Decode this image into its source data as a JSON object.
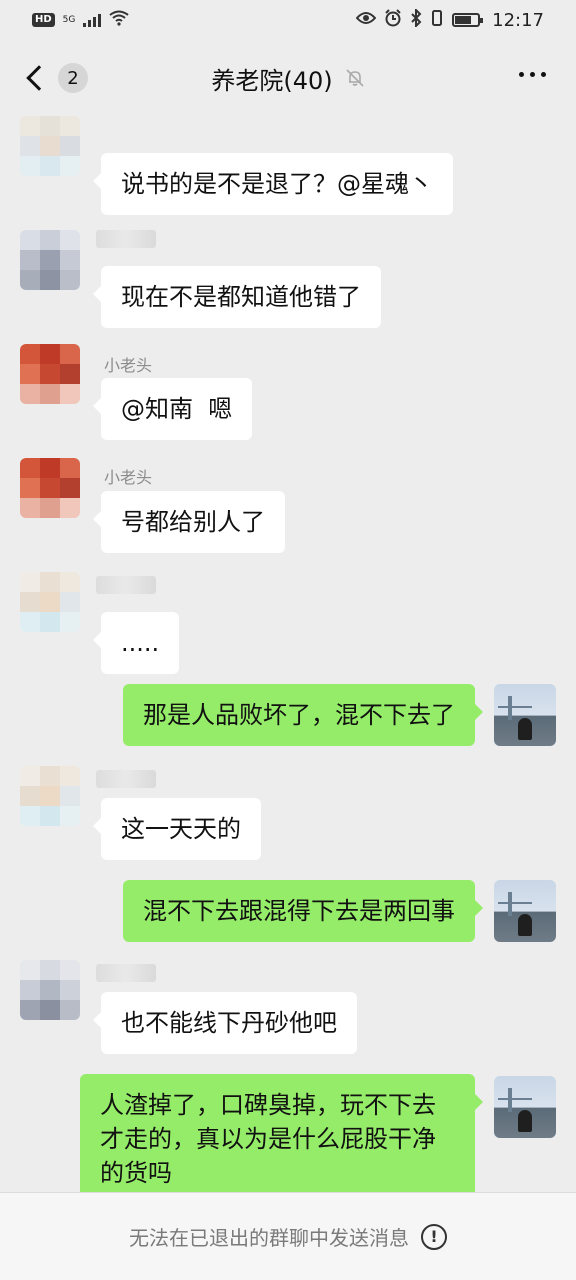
{
  "status_bar": {
    "hd": "HD",
    "network": "5G",
    "time": "12:17"
  },
  "header": {
    "unread_count": "2",
    "title": "养老院(40)"
  },
  "messages": [
    {
      "side": "in",
      "sender": "",
      "text": "说书的是不是退了？@星魂丶"
    },
    {
      "side": "in",
      "sender": "",
      "text": "现在不是都知道他错了"
    },
    {
      "side": "in",
      "sender": "小老头",
      "text": "@知南  嗯"
    },
    {
      "side": "in",
      "sender": "小老头",
      "text": "号都给别人了"
    },
    {
      "side": "in",
      "sender": "",
      "text": "....."
    },
    {
      "side": "out",
      "sender": "",
      "text": "那是人品败坏了，混不下去了"
    },
    {
      "side": "in",
      "sender": "",
      "text": "这一天天的"
    },
    {
      "side": "out",
      "sender": "",
      "text": "混不下去跟混得下去是两回事"
    },
    {
      "side": "in",
      "sender": "",
      "text": "也不能线下丹砂他吧"
    },
    {
      "side": "out",
      "sender": "",
      "text": "人渣掉了，口碑臭掉，玩不下去才走的，真以为是什么屁股干净的货吗"
    }
  ],
  "footer": {
    "notice": "无法在已退出的群聊中发送消息"
  },
  "colors": {
    "background": "#ededed",
    "incoming_bubble": "#ffffff",
    "outgoing_bubble": "#95ec69"
  }
}
